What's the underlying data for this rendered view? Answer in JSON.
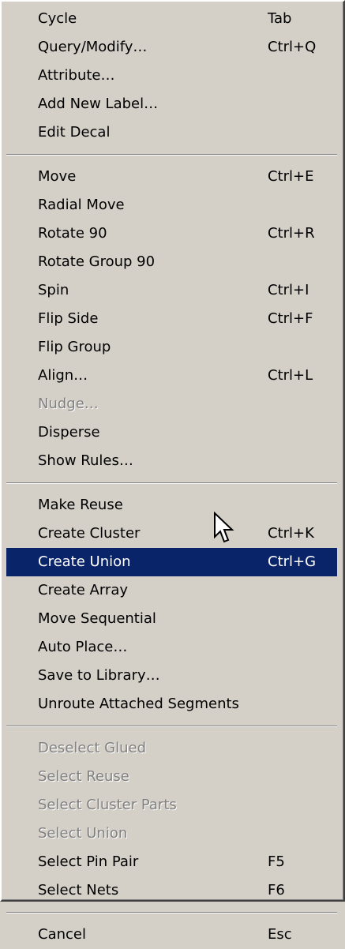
{
  "menu": {
    "groups": [
      [
        {
          "label": "Cycle",
          "shortcut": "Tab",
          "enabled": true
        },
        {
          "label": "Query/Modify…",
          "shortcut": "Ctrl+Q",
          "enabled": true
        },
        {
          "label": "Attribute…",
          "shortcut": "",
          "enabled": true
        },
        {
          "label": "Add New Label…",
          "shortcut": "",
          "enabled": true
        },
        {
          "label": "Edit Decal",
          "shortcut": "",
          "enabled": true
        }
      ],
      [
        {
          "label": "Move",
          "shortcut": "Ctrl+E",
          "enabled": true
        },
        {
          "label": "Radial Move",
          "shortcut": "",
          "enabled": true
        },
        {
          "label": "Rotate 90",
          "shortcut": "Ctrl+R",
          "enabled": true
        },
        {
          "label": "Rotate Group 90",
          "shortcut": "",
          "enabled": true
        },
        {
          "label": "Spin",
          "shortcut": "Ctrl+I",
          "enabled": true
        },
        {
          "label": "Flip Side",
          "shortcut": "Ctrl+F",
          "enabled": true
        },
        {
          "label": "Flip Group",
          "shortcut": "",
          "enabled": true
        },
        {
          "label": "Align…",
          "shortcut": "Ctrl+L",
          "enabled": true
        },
        {
          "label": "Nudge…",
          "shortcut": "",
          "enabled": false
        },
        {
          "label": "Disperse",
          "shortcut": "",
          "enabled": true
        },
        {
          "label": "Show Rules…",
          "shortcut": "",
          "enabled": true
        }
      ],
      [
        {
          "label": "Make Reuse",
          "shortcut": "",
          "enabled": true
        },
        {
          "label": "Create Cluster",
          "shortcut": "Ctrl+K",
          "enabled": true
        },
        {
          "label": "Create Union",
          "shortcut": "Ctrl+G",
          "enabled": true,
          "highlighted": true
        },
        {
          "label": "Create Array",
          "shortcut": "",
          "enabled": true
        },
        {
          "label": "Move Sequential",
          "shortcut": "",
          "enabled": true
        },
        {
          "label": "Auto Place…",
          "shortcut": "",
          "enabled": true
        },
        {
          "label": "Save to Library…",
          "shortcut": "",
          "enabled": true
        },
        {
          "label": "Unroute Attached Segments",
          "shortcut": "",
          "enabled": true
        }
      ],
      [
        {
          "label": "Deselect Glued",
          "shortcut": "",
          "enabled": false
        },
        {
          "label": "Select Reuse",
          "shortcut": "",
          "enabled": false
        },
        {
          "label": "Select Cluster Parts",
          "shortcut": "",
          "enabled": false
        },
        {
          "label": "Select Union",
          "shortcut": "",
          "enabled": false
        },
        {
          "label": "Select Pin Pair",
          "shortcut": "F5",
          "enabled": true
        },
        {
          "label": "Select Nets",
          "shortcut": "F6",
          "enabled": true
        }
      ],
      [
        {
          "label": "Cancel",
          "shortcut": "Esc",
          "enabled": true
        }
      ]
    ]
  },
  "colors": {
    "menu_background": "#d4d0c8",
    "highlight_background": "#0a246a",
    "highlight_text": "#ffffff",
    "disabled_text": "#808080"
  },
  "cursor": {
    "icon": "arrow-pointer-icon"
  }
}
